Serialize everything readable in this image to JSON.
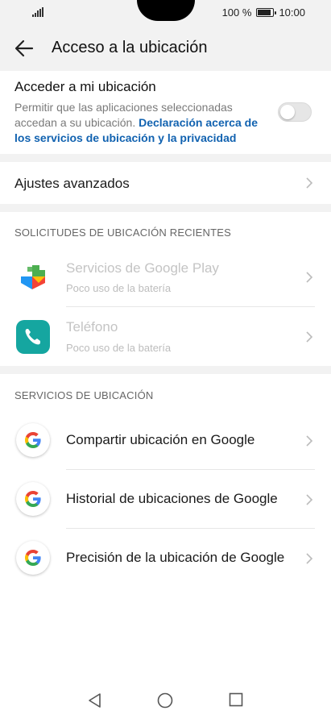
{
  "status_bar": {
    "battery_text": "100 %",
    "time": "10:00"
  },
  "header": {
    "title": "Acceso a la ubicación"
  },
  "location_access": {
    "label": "Acceder a mi ubicación",
    "description": "Permitir que las aplicaciones seleccionadas accedan a su ubicación.",
    "link_text": "Declaración acerca de los servicios de ubicación y la privacidad",
    "toggle_on": false
  },
  "advanced_settings": {
    "label": "Ajustes avanzados"
  },
  "recent_requests": {
    "header": "SOLICITUDES DE UBICACIÓN RECIENTES",
    "items": [
      {
        "label": "Servicios de Google Play",
        "sub": "Poco uso de la batería",
        "icon": "google-play-services-icon"
      },
      {
        "label": "Teléfono",
        "sub": "Poco uso de la batería",
        "icon": "phone-app-icon"
      }
    ]
  },
  "location_services": {
    "header": "SERVICIOS DE UBICACIÓN",
    "items": [
      {
        "label": "Compartir ubicación en Google",
        "icon": "google-icon"
      },
      {
        "label": "Historial de ubicaciones de Google",
        "icon": "google-icon"
      },
      {
        "label": "Precisión de la ubicación de Google",
        "icon": "google-icon"
      }
    ]
  },
  "colors": {
    "link": "#1162b0",
    "phone_icon_bg": "#15a6a0"
  }
}
